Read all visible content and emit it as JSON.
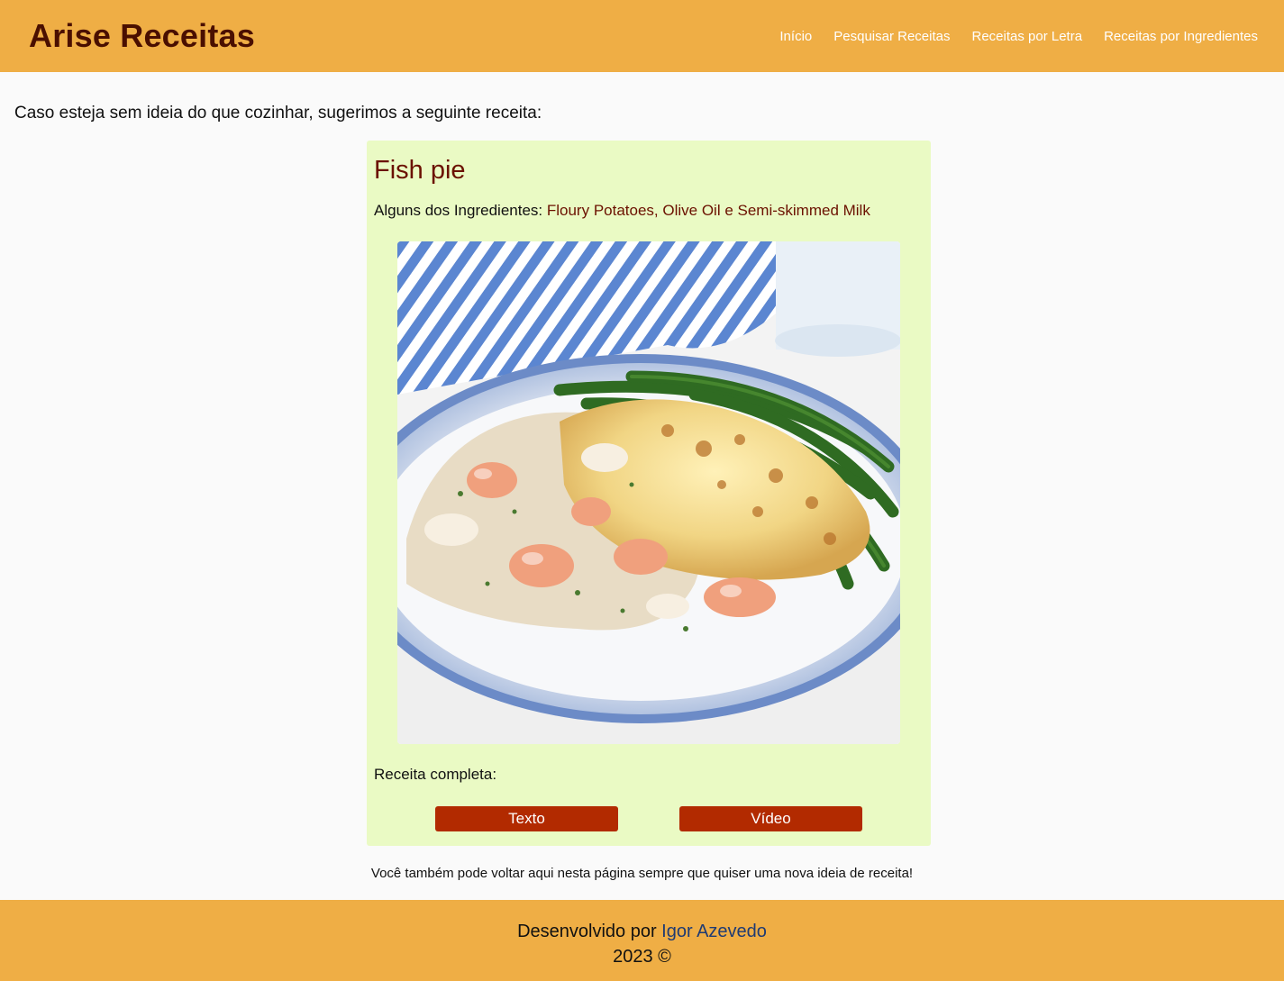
{
  "header": {
    "brand": "Arise Receitas",
    "nav": [
      {
        "label": "Início"
      },
      {
        "label": "Pesquisar Receitas"
      },
      {
        "label": "Receitas por Letra"
      },
      {
        "label": "Receitas por Ingredientes"
      }
    ]
  },
  "main": {
    "intro": "Caso esteja sem ideia do que cozinhar, sugerimos a seguinte receita:",
    "recipe": {
      "title": "Fish pie",
      "ingredients_label": "Alguns dos Ingredientes:",
      "ingredients_list": "Floury Potatoes, Olive Oil e Semi-skimmed Milk",
      "full_label": "Receita completa:",
      "text_button": "Texto",
      "video_button": "Vídeo"
    },
    "hint": "Você também pode voltar aqui nesta página sempre que quiser uma nova ideia de receita!"
  },
  "footer": {
    "developed_by": "Desenvolvido por",
    "author": "Igor Azevedo",
    "year": "2023 ©"
  },
  "colors": {
    "header_bg": "#efae45",
    "brand": "#4a0f00",
    "card_bg": "#eafac4",
    "accent_text": "#6b1100",
    "button_bg": "#b22a00",
    "link": "#1f3b73"
  }
}
